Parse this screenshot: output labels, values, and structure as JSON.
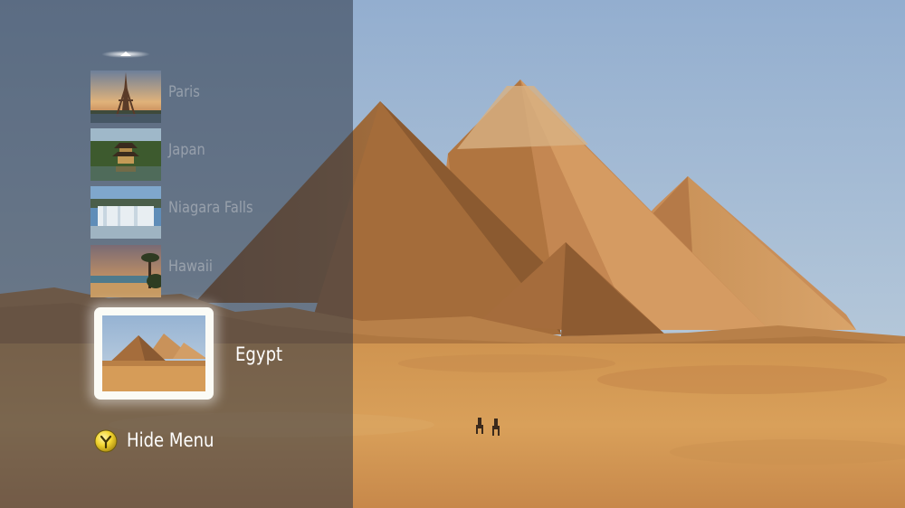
{
  "background": {
    "name": "egypt-pyramids-background"
  },
  "menu": {
    "items": [
      {
        "label": "Paris",
        "icon": "eiffel-tower-thumbnail"
      },
      {
        "label": "Japan",
        "icon": "japanese-temple-thumbnail"
      },
      {
        "label": "Niagara Falls",
        "icon": "waterfall-thumbnail"
      },
      {
        "label": "Hawaii",
        "icon": "tropical-beach-thumbnail"
      }
    ],
    "selected": {
      "label": "Egypt",
      "icon": "pyramids-thumbnail"
    },
    "hide_menu": {
      "label": "Hide Menu",
      "button_icon": "y-button-icon"
    }
  },
  "colors": {
    "sky": "#9db7d2",
    "sand": "#d69a52",
    "overlay": "#2d3646",
    "button_yellow": "#f2d530"
  }
}
